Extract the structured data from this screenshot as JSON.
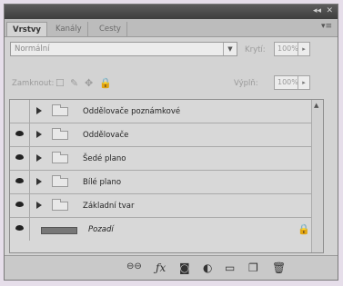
{
  "tabs": [
    {
      "label": "Vrstvy",
      "active": true
    },
    {
      "label": "Kanály",
      "active": false
    },
    {
      "label": "Cesty",
      "active": false
    }
  ],
  "blend_mode": "Normální",
  "opacity_label": "Krytí:",
  "opacity_value": "100%",
  "lock_label": "Zamknout:",
  "fill_label": "Výplň:",
  "fill_value": "100%",
  "layers": [
    {
      "name": "Oddělovače poznámkové",
      "visible": false,
      "type": "group"
    },
    {
      "name": "Oddělovače",
      "visible": true,
      "type": "group"
    },
    {
      "name": "Šedé plano",
      "visible": true,
      "type": "group"
    },
    {
      "name": "Bílé plano",
      "visible": true,
      "type": "group"
    },
    {
      "name": "Základní tvar",
      "visible": true,
      "type": "group"
    },
    {
      "name": "Pozadí",
      "visible": true,
      "type": "background"
    }
  ],
  "colors": {
    "panel_bg": "#d3d3d3",
    "titlebar": "#4a4a4a",
    "page_bg": "#e6deea"
  }
}
